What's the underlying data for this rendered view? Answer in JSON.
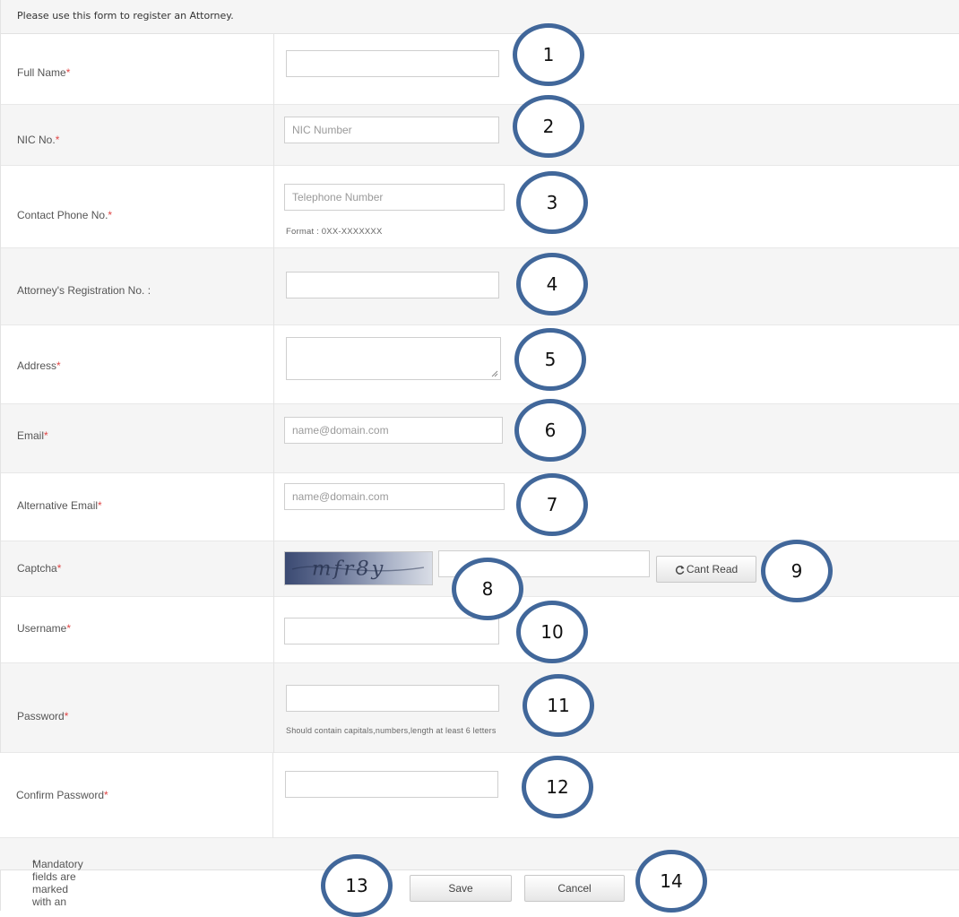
{
  "header": {
    "instruction": "Please use this form to register an Attorney."
  },
  "fields": {
    "full_name": {
      "label": "Full Name",
      "required_mark": "*",
      "value": "",
      "placeholder": ""
    },
    "nic": {
      "label": "NIC No.",
      "required_mark": "*",
      "value": "",
      "placeholder": "NIC Number"
    },
    "phone": {
      "label": "Contact Phone No.",
      "required_mark": "*",
      "value": "",
      "placeholder": "Telephone Number",
      "hint": "Format : 0XX-XXXXXXX"
    },
    "registration": {
      "label": "Attorney's Registration No. :",
      "value": "",
      "placeholder": ""
    },
    "address": {
      "label": "Address",
      "required_mark": "*",
      "value": "",
      "placeholder": ""
    },
    "email": {
      "label": "Email",
      "required_mark": "*",
      "value": "",
      "placeholder": "name@domain.com"
    },
    "alt_email": {
      "label": "Alternative Email",
      "required_mark": "*",
      "value": "",
      "placeholder": "name@domain.com"
    },
    "captcha": {
      "label": "Captcha",
      "required_mark": "*",
      "image_text": "mfr8y",
      "value": "",
      "placeholder": "",
      "cant_read_label": "Cant Read"
    },
    "username": {
      "label": "Username",
      "required_mark": "*",
      "value": "",
      "placeholder": ""
    },
    "password": {
      "label": "Password",
      "required_mark": "*",
      "value": "",
      "placeholder": "",
      "hint": "Should contain capitals,numbers,length at least 6 letters"
    },
    "confirm_password": {
      "label": "Confirm Password",
      "required_mark": "*",
      "value": "",
      "placeholder": ""
    }
  },
  "footer": {
    "mandatory_note": "Mandatory fields are marked with an",
    "required_mark": "*"
  },
  "actions": {
    "save_label": "Save",
    "cancel_label": "Cancel"
  },
  "callouts": [
    "1",
    "2",
    "3",
    "4",
    "5",
    "6",
    "7",
    "8",
    "9",
    "10",
    "11",
    "12",
    "13",
    "14"
  ],
  "colors": {
    "callout_border": "#41679a",
    "required": "#e04646",
    "alt_row": "#f5f5f5"
  }
}
